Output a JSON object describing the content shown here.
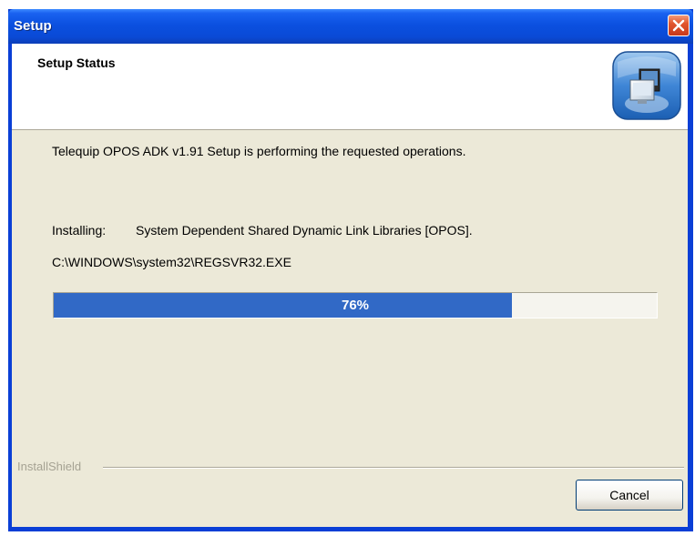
{
  "window": {
    "title": "Setup"
  },
  "header": {
    "title": "Setup Status",
    "icon": "installer-computer-icon"
  },
  "body": {
    "status_message": "Telequip OPOS ADK v1.91 Setup is performing the requested operations.",
    "installing_label": "Installing:",
    "installing_value": "System Dependent Shared Dynamic Link Libraries [OPOS].",
    "file_path": "C:\\WINDOWS\\system32\\REGSVR32.EXE"
  },
  "progress": {
    "percent": 76,
    "label": "76%"
  },
  "footer": {
    "brand": "InstallShield",
    "cancel_label": "Cancel"
  },
  "colors": {
    "titlebar": "#0a4ad6",
    "progress_fill": "#3169c6",
    "dialog_bg": "#ece9d8",
    "close_button": "#e1562e"
  }
}
